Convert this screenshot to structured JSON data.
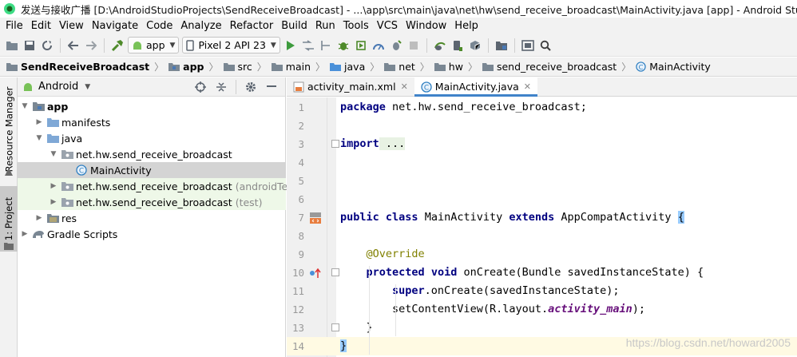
{
  "window": {
    "title": "发送与接收广播 [D:\\AndroidStudioProjects\\SendReceiveBroadcast] - ...\\app\\src\\main\\java\\net\\hw\\send_receive_broadcast\\MainActivity.java [app] - Android Studio (Adm"
  },
  "menu": [
    "File",
    "Edit",
    "View",
    "Navigate",
    "Code",
    "Analyze",
    "Refactor",
    "Build",
    "Run",
    "Tools",
    "VCS",
    "Window",
    "Help"
  ],
  "toolbar": {
    "run_config": "app",
    "device": "Pixel 2 API 23"
  },
  "breadcrumb": [
    "SendReceiveBroadcast",
    "app",
    "src",
    "main",
    "java",
    "net",
    "hw",
    "send_receive_broadcast",
    "MainActivity"
  ],
  "side_tabs": {
    "resource_manager": "Resource Manager",
    "project": "1: Project"
  },
  "project": {
    "view_mode": "Android",
    "tree": [
      {
        "label": "app",
        "extra": ""
      },
      {
        "label": "manifests",
        "extra": ""
      },
      {
        "label": "java",
        "extra": ""
      },
      {
        "label": "net.hw.send_receive_broadcast",
        "extra": ""
      },
      {
        "label": "MainActivity",
        "extra": ""
      },
      {
        "label": "net.hw.send_receive_broadcast",
        "extra": "(androidTest)"
      },
      {
        "label": "net.hw.send_receive_broadcast",
        "extra": "(test)"
      },
      {
        "label": "res",
        "extra": ""
      },
      {
        "label": "Gradle Scripts",
        "extra": ""
      }
    ]
  },
  "editor": {
    "tabs": [
      {
        "label": "activity_main.xml"
      },
      {
        "label": "MainActivity.java"
      }
    ],
    "line_numbers": [
      "1",
      "2",
      "3",
      "4",
      "5",
      "6",
      "7",
      "8",
      "9",
      "10",
      "11",
      "12",
      "13",
      "14"
    ],
    "code": {
      "l1_kw": "package",
      "l1_rest": " net.hw.send_receive_broadcast;",
      "l3_kw": "import",
      "l3_rest": " ...",
      "l7_kw1": "public",
      "l7_kw2": "class",
      "l7_name": " MainActivity ",
      "l7_kw3": "extends",
      "l7_rest": " AppCompatActivity ",
      "l7_brace": "{",
      "l9_ann": "@Override",
      "l10_kw1": "protected",
      "l10_kw2": "void",
      "l10_rest": " onCreate(Bundle savedInstanceState) {",
      "l11_kw": "super",
      "l11_rest": ".onCreate(savedInstanceState);",
      "l12_pre": "setContentView(R.layout.",
      "l12_ital": "activity_main",
      "l12_post": ");",
      "l13": "}",
      "l14": "}"
    }
  },
  "watermark": "https://blog.csdn.net/howard2005"
}
